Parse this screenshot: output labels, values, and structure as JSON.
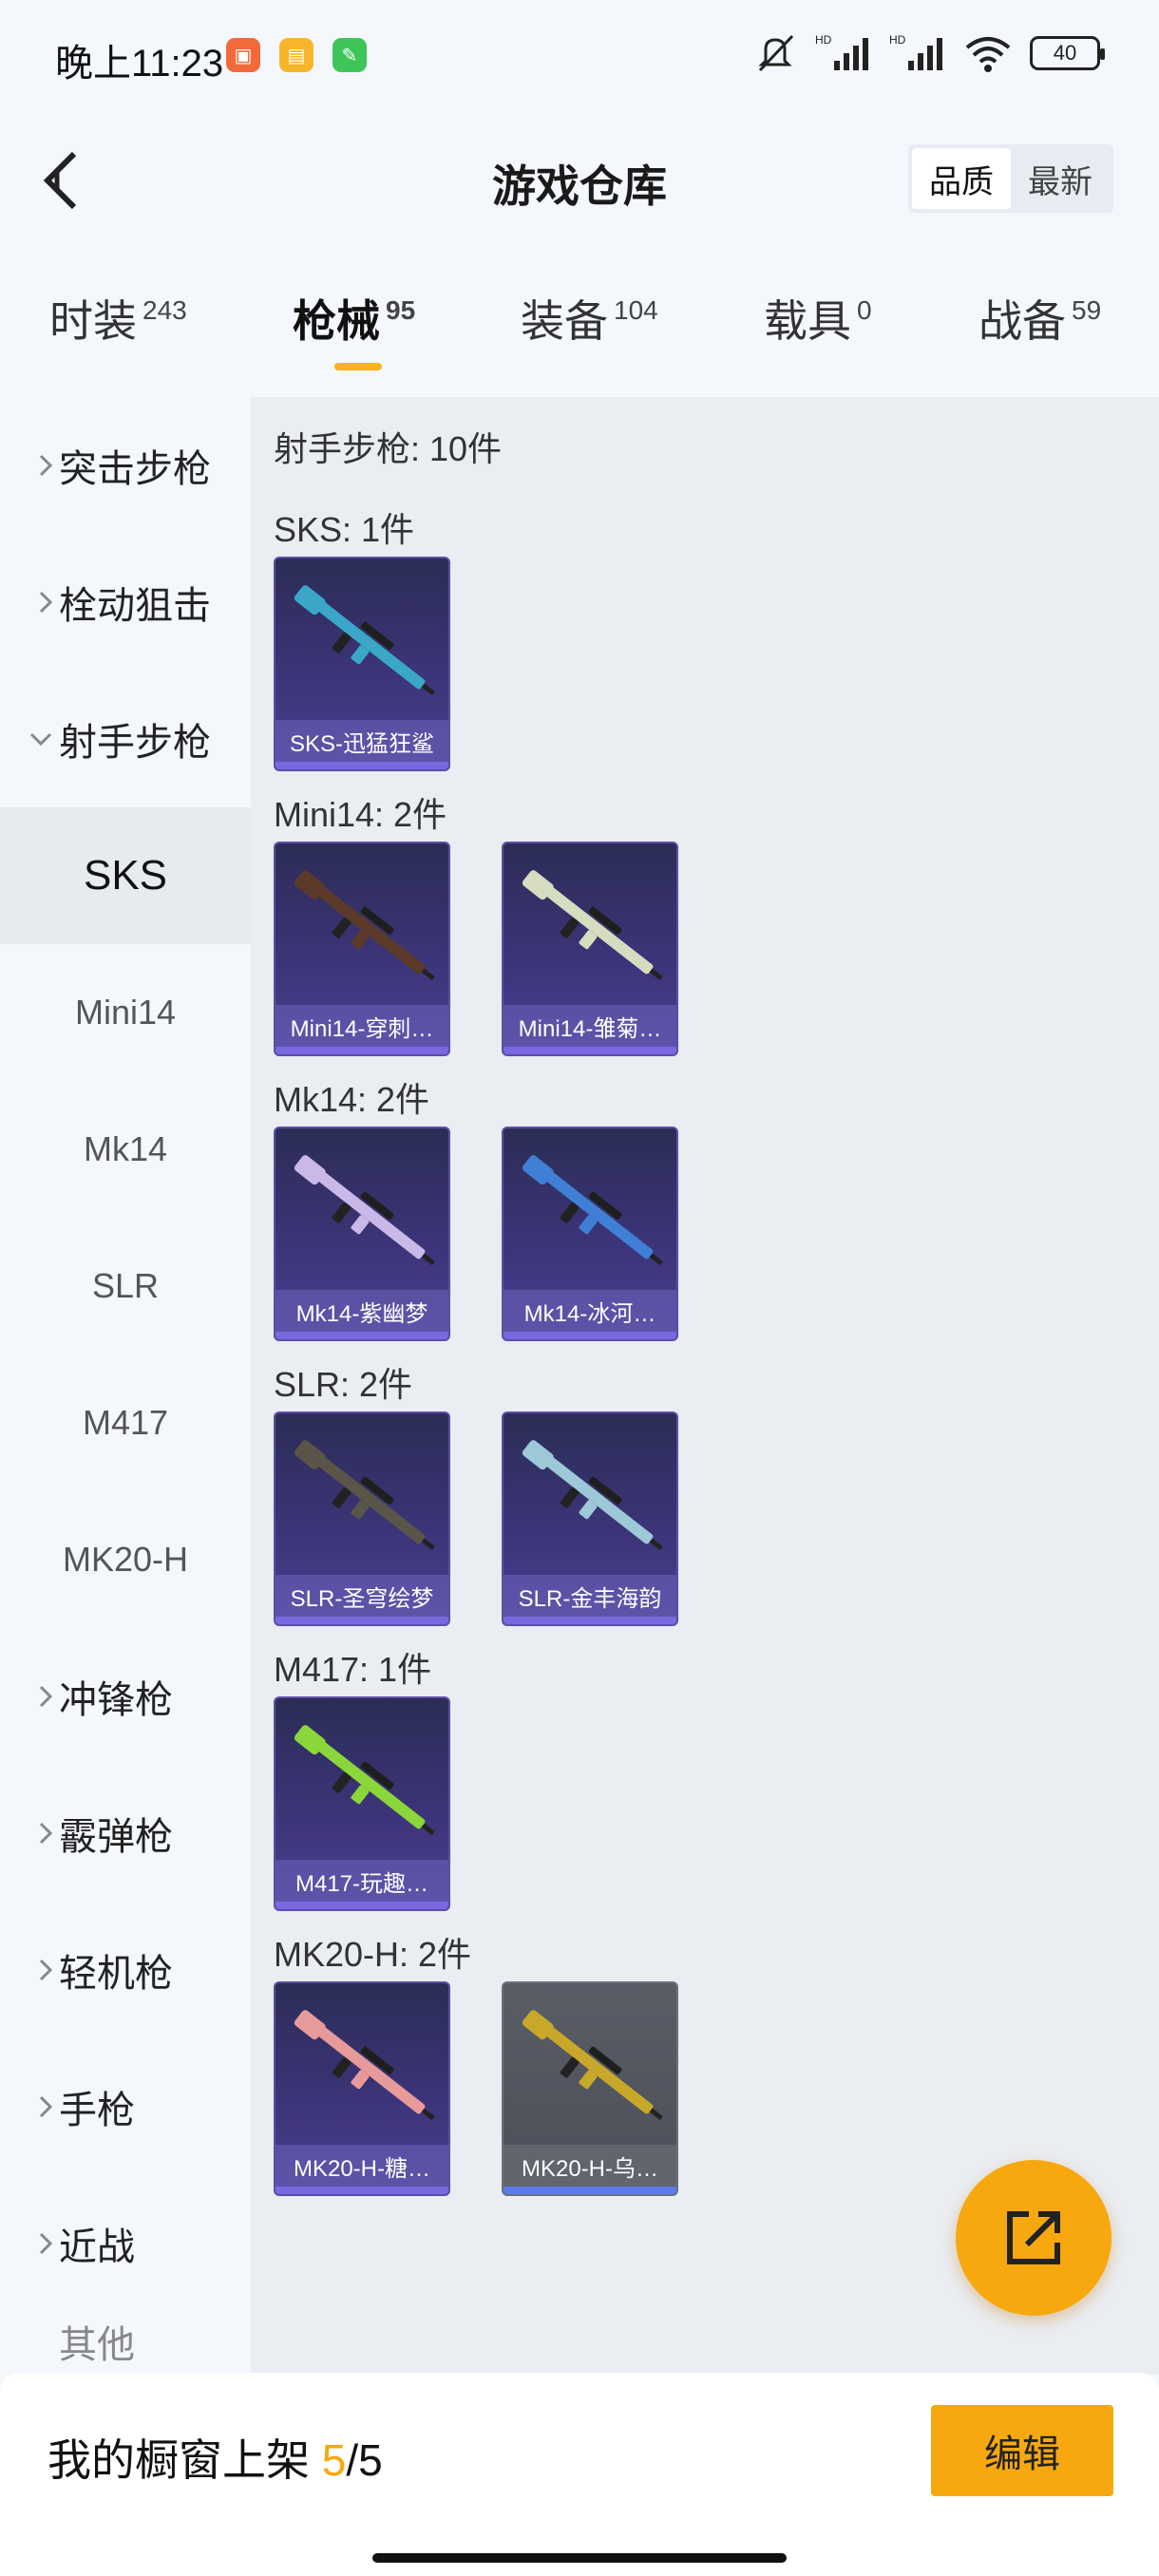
{
  "status": {
    "time": "晚上11:23",
    "battery": "40"
  },
  "header": {
    "title": "游戏仓库",
    "sort_quality": "品质",
    "sort_newest": "最新"
  },
  "tabs": [
    {
      "label": "时装",
      "count": "243"
    },
    {
      "label": "枪械",
      "count": "95"
    },
    {
      "label": "装备",
      "count": "104"
    },
    {
      "label": "载具",
      "count": "0"
    },
    {
      "label": "战备",
      "count": "59"
    }
  ],
  "sidebar": {
    "cat_assault": "突击步枪",
    "cat_bolt": "栓动狙击",
    "cat_dmr": "射手步枪",
    "sub_sks": "SKS",
    "sub_mini14": "Mini14",
    "sub_mk14": "Mk14",
    "sub_slr": "SLR",
    "sub_m417": "M417",
    "sub_mk20h": "MK20-H",
    "cat_smg": "冲锋枪",
    "cat_shotgun": "霰弹枪",
    "cat_lmg": "轻机枪",
    "cat_pistol": "手枪",
    "cat_melee": "近战",
    "cat_other": "其他"
  },
  "content": {
    "section_title": "射手步枪: 10件",
    "groups": [
      {
        "title": "SKS: 1件",
        "items": [
          "SKS-迅猛狂鲨"
        ]
      },
      {
        "title": "Mini14: 2件",
        "items": [
          "Mini14-穿刺…",
          "Mini14-雏菊…"
        ]
      },
      {
        "title": "Mk14: 2件",
        "items": [
          "Mk14-紫幽梦",
          "Mk14-冰河…"
        ]
      },
      {
        "title": "SLR: 2件",
        "items": [
          "SLR-圣穹绘梦",
          "SLR-金丰海韵"
        ]
      },
      {
        "title": "M417: 1件",
        "items": [
          "M417-玩趣…"
        ]
      },
      {
        "title": "MK20-H: 2件",
        "items": [
          "MK20-H-糖…",
          "MK20-H-乌…"
        ]
      }
    ]
  },
  "bottom": {
    "shelf_label": "我的橱窗上架",
    "shelf_current": "5",
    "shelf_total": "/5",
    "edit_label": "编辑"
  },
  "colors": {
    "accent": "#f7a80f",
    "card_purple": "#3c3478",
    "card_gray": "#595d66"
  },
  "icons": {
    "back": "back-arrow-icon",
    "share": "external-link-icon",
    "chevron": "chevron-right-icon"
  }
}
